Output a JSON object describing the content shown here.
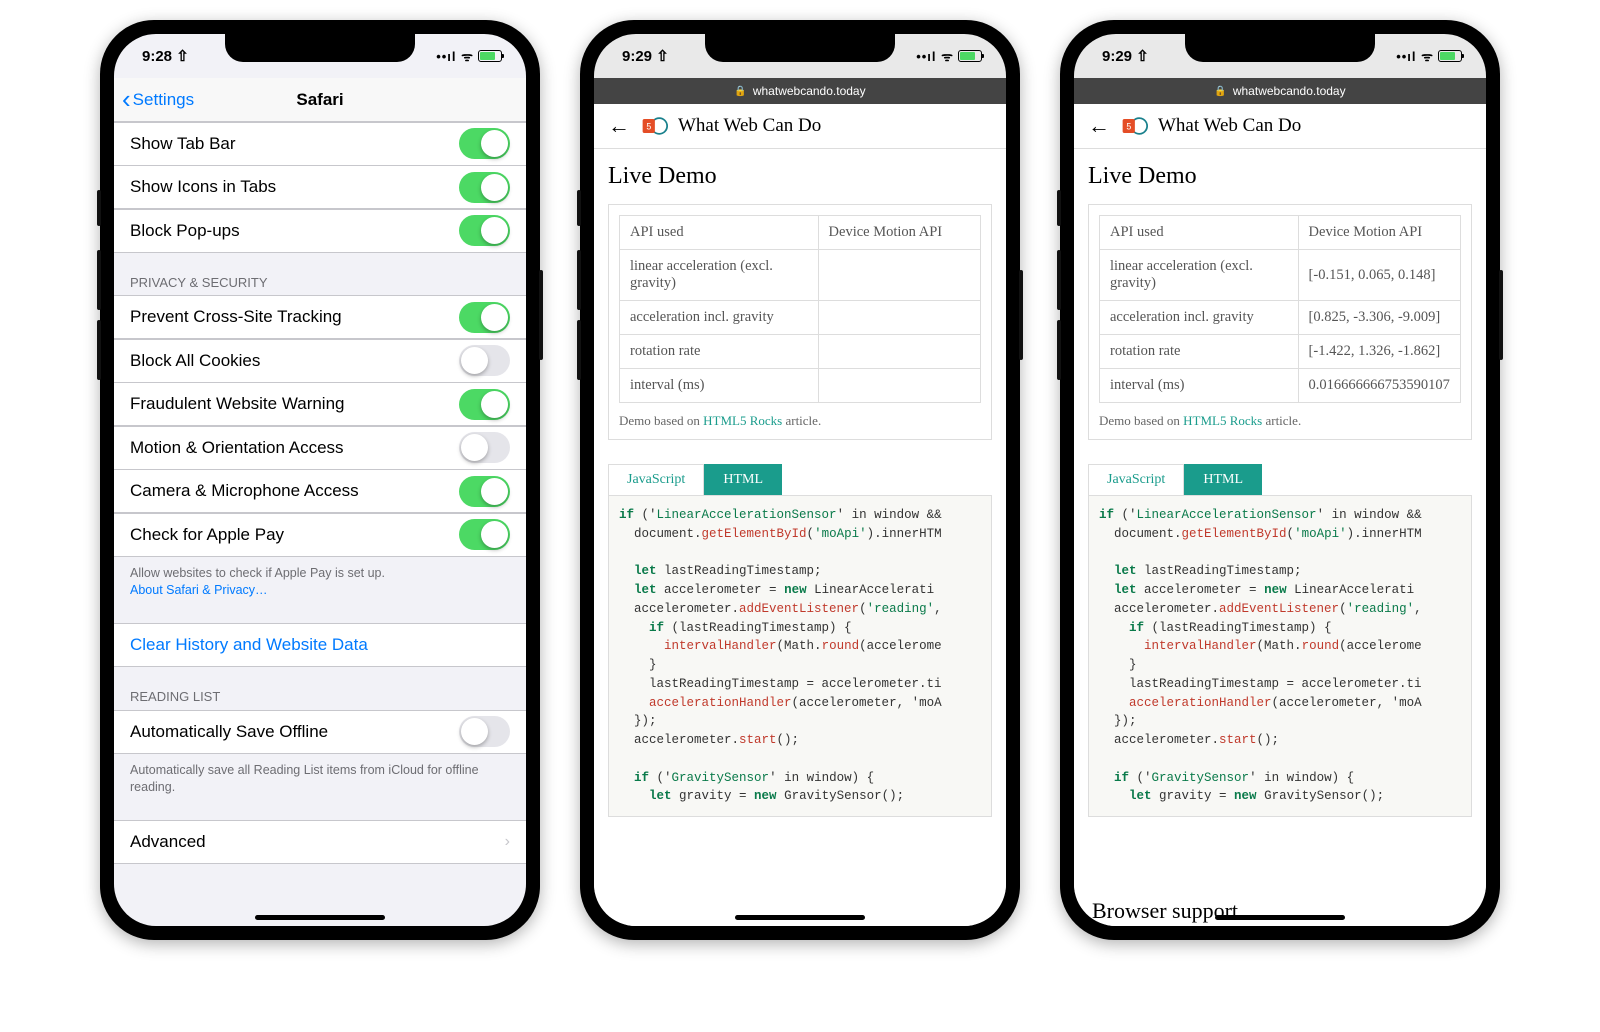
{
  "phone1": {
    "time": "9:28",
    "nav_back": "Settings",
    "nav_title": "Safari",
    "group0": [
      {
        "label": "Show Tab Bar",
        "on": true
      },
      {
        "label": "Show Icons in Tabs",
        "on": true
      },
      {
        "label": "Block Pop-ups",
        "on": true
      }
    ],
    "group1_header": "Privacy & Security",
    "group1": [
      {
        "label": "Prevent Cross-Site Tracking",
        "on": true
      },
      {
        "label": "Block All Cookies",
        "on": false
      },
      {
        "label": "Fraudulent Website Warning",
        "on": true
      },
      {
        "label": "Motion & Orientation Access",
        "on": false
      },
      {
        "label": "Camera & Microphone Access",
        "on": true
      },
      {
        "label": "Check for Apple Pay",
        "on": true
      }
    ],
    "group1_footer": "Allow websites to check if Apple Pay is set up.",
    "group1_footer_link": "About Safari & Privacy…",
    "clear_label": "Clear History and Website Data",
    "group2_header": "Reading List",
    "group2": [
      {
        "label": "Automatically Save Offline",
        "on": false
      }
    ],
    "group2_footer": "Automatically save all Reading List items from iCloud for offline reading.",
    "advanced_label": "Advanced"
  },
  "phone2": {
    "time": "9:29",
    "url": "whatwebcando.today",
    "site_title": "What Web Can Do",
    "live_demo": "Live Demo",
    "table": [
      [
        "API used",
        "Device Motion API"
      ],
      [
        "linear acceleration (excl. gravity)",
        ""
      ],
      [
        "acceleration incl. gravity",
        ""
      ],
      [
        "rotation rate",
        ""
      ],
      [
        "interval (ms)",
        ""
      ]
    ],
    "demo_footer_pre": "Demo based on ",
    "demo_footer_link": "HTML5 Rocks",
    "demo_footer_post": " article.",
    "tab_js": "JavaScript",
    "tab_html": "HTML"
  },
  "phone3": {
    "time": "9:29",
    "url": "whatwebcando.today",
    "site_title": "What Web Can Do",
    "live_demo": "Live Demo",
    "table": [
      [
        "API used",
        "Device Motion API"
      ],
      [
        "linear acceleration (excl. gravity)",
        "[-0.151, 0.065, 0.148]"
      ],
      [
        "acceleration incl. gravity",
        "[0.825, -3.306, -9.009]"
      ],
      [
        "rotation rate",
        "[-1.422, 1.326, -1.862]"
      ],
      [
        "interval (ms)",
        "0.016666666753590107"
      ]
    ],
    "demo_footer_pre": "Demo based on ",
    "demo_footer_link": "HTML5 Rocks",
    "demo_footer_post": " article.",
    "tab_js": "JavaScript",
    "tab_html": "HTML",
    "browser_support": "Browser support"
  },
  "code_lines": [
    {
      "t": "if ('",
      "a": "LinearAccelerationSensor",
      "b": "' in window &&"
    },
    {
      "t": "  document.",
      "f": "getElementById",
      "b": "('moApi').innerHTM"
    },
    {
      "t": ""
    },
    {
      "t": "  let lastReadingTimestamp;"
    },
    {
      "t": "  let accelerometer = new LinearAccelerati"
    },
    {
      "t": "  accelerometer.",
      "f": "addEventListener",
      "b": "('reading',"
    },
    {
      "t": "    if (lastReadingTimestamp) {"
    },
    {
      "t": "      ",
      "f": "intervalHandler",
      "b": "(Math.",
      "f2": "round",
      "b2": "(accelerome"
    },
    {
      "t": "    }"
    },
    {
      "t": "    lastReadingTimestamp = accelerometer.ti"
    },
    {
      "t": "    ",
      "f": "accelerationHandler",
      "b": "(accelerometer, 'moA"
    },
    {
      "t": "  });"
    },
    {
      "t": "  accelerometer.",
      "f": "start",
      "b": "();"
    },
    {
      "t": ""
    },
    {
      "t": "  if ('",
      "a": "GravitySensor",
      "b": "' in window) {"
    },
    {
      "t": "    let gravity = new GravitySensor();"
    }
  ]
}
